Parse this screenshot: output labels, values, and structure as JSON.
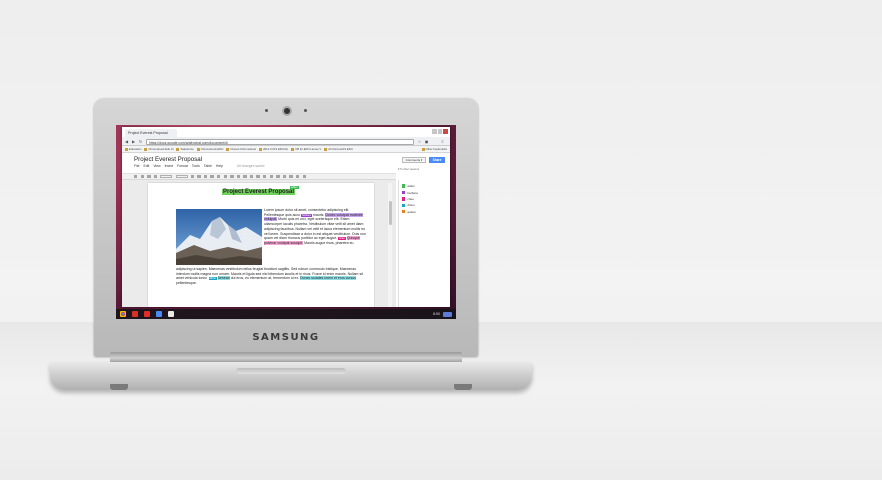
{
  "laptop": {
    "brand": "SAMSUNG"
  },
  "browser": {
    "tab_title": "Project Everest Proposal",
    "url": "https://docs.google.com/a/afrostrat.com/document/d/",
    "nav": {
      "back": "◀",
      "forward": "▶",
      "reload": "↻",
      "menu": "≡"
    },
    "bookmarks": [
      "Education",
      "Chromebook Edu Ki",
      "Salesforce",
      "Chromebook EDU",
      "Cloned Chromebook",
      "2012 CrOS EDU Re",
      "CB for EDU House V",
      "All ChromeOS EDU"
    ],
    "other_bookmarks": "Other bookmarks"
  },
  "docs": {
    "title": "Project Everest Proposal",
    "menu": [
      "File",
      "Edit",
      "View",
      "Insert",
      "Format",
      "Tools",
      "Table",
      "Help"
    ],
    "saved_status": "All changes saved",
    "comments_label": "Comments ▾",
    "share_label": "Share",
    "viewers_label": "▾ 5 other viewers",
    "font_style": "Normal text",
    "font_name": "Arial",
    "font_size": "11",
    "heading": "Project Everest Proposal",
    "heading_flag": "adam",
    "paragraph_1": [
      {
        "text": "Lorem ipsum dolor sit amet, consectetur adipiscing elit. Pellentesque quis accu",
        "hl": ""
      },
      {
        "text": "mauris.",
        "hl": ""
      },
      {
        "text": "Donec volutpat molestie volutpat.",
        "hl": "purple"
      },
      {
        "text": " Morbi quis mi orci, eget scelerisque elit. Etiam ullamcorper iaculis pharetra. Vestibulum vitae velit sit amet diam adipiscing faucibus. Nullam vel velit et lacus elementum mollis eu vel lorem. Suspendisse a dolor in est aliquet vestibulum. Duis non quam vel diam rhoncus porttitor ac eget augue. ",
        "hl": ""
      },
      {
        "text": "Quisque pulvinar volutpat suscipit.",
        "hl": "pink"
      },
      {
        "text": " Mauris augue risus, pharetra eu",
        "hl": ""
      }
    ],
    "paragraph_2": [
      {
        "text": "adipiscing ut sapien. Maecenas vestibulum tellus feugiat tincidunt sagittis. Sed rutrum commodo tristique. Maecenas interdum mollis magna non ornare. Mauris et ligula sed nisl bibendum iaculis et in risus. Fusce id enim mauris. Nullam sit amet vehicula tortor. ",
        "hl": ""
      },
      {
        "text": "Aenean",
        "hl": "teal"
      },
      {
        "text": " dui eros, eu elementum at, fermentum id ex. ",
        "hl": ""
      },
      {
        "text": "Donec sodales lorem et eros cursus",
        "hl": "teal"
      },
      {
        "text": " pellentesque.",
        "hl": ""
      }
    ],
    "flags": {
      "purple": "barbara",
      "pink": "chee",
      "teal": "dihoo"
    },
    "collaborators": [
      {
        "name": "adam",
        "color": "#3cba54"
      },
      {
        "name": "barbara",
        "color": "#9b3fd0"
      },
      {
        "name": "chee",
        "color": "#e21f85"
      },
      {
        "name": "dihoo",
        "color": "#1fa7c2"
      },
      {
        "name": "avatar",
        "color": "#f07d19"
      }
    ]
  },
  "shelf": {
    "time": "8:50"
  },
  "colors": {
    "accent": "#4a8af4",
    "heading_highlight": "#6fd05b"
  }
}
